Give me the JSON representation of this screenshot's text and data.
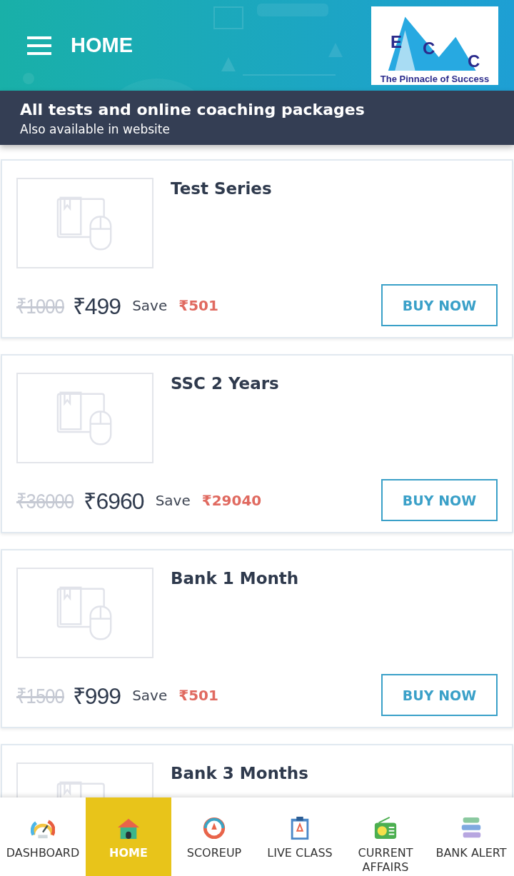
{
  "header": {
    "title": "HOME",
    "logo": {
      "letters": [
        "E",
        "C",
        "C"
      ],
      "tagline": "The Pinnacle of Success"
    }
  },
  "banner": {
    "title": "All tests and online coaching packages",
    "subtitle": "Also available in website"
  },
  "packages": [
    {
      "name": "Test Series",
      "old_price": "₹1000",
      "price": "₹499",
      "save_label": "Save",
      "saving": "₹501",
      "button": "BUY NOW"
    },
    {
      "name": "SSC 2 Years",
      "old_price": "₹36000",
      "price": "₹6960",
      "save_label": "Save",
      "saving": "₹29040",
      "button": "BUY NOW"
    },
    {
      "name": "Bank 1 Month",
      "old_price": "₹1500",
      "price": "₹999",
      "save_label": "Save",
      "saving": "₹501",
      "button": "BUY NOW"
    },
    {
      "name": "Bank 3 Months"
    }
  ],
  "nav": [
    {
      "kind": "gauge",
      "label": "DASHBOARD",
      "selected": false
    },
    {
      "kind": "house",
      "label": "HOME",
      "selected": true
    },
    {
      "kind": "score",
      "label": "SCOREUP",
      "selected": false
    },
    {
      "kind": "clipboard",
      "label": "LIVE CLASS",
      "selected": false
    },
    {
      "kind": "radio",
      "label": "CURRENT AFFAIRS",
      "selected": false
    },
    {
      "kind": "stack",
      "label": "BANK ALERT",
      "selected": false
    }
  ]
}
